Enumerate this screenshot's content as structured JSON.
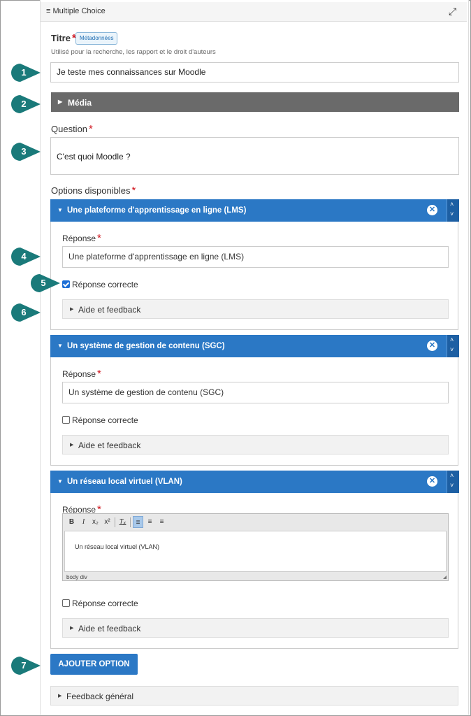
{
  "header": {
    "title": "Multiple Choice",
    "list_icon": "list-icon",
    "expand_icon": "expand-icon"
  },
  "titre": {
    "label": "Titre",
    "required": "*",
    "badge": "Métadonnées",
    "hint": "Utilisé pour la recherche, les rapport et le droit d'auteurs",
    "value": "Je teste mes connaissances sur Moodle"
  },
  "media": {
    "label": "Média"
  },
  "question": {
    "label": "Question",
    "required": "*",
    "value": "C'est quoi Moodle ?"
  },
  "options": {
    "label": "Options disponibles",
    "required": "*",
    "items": [
      {
        "title": "Une plateforme d'apprentissage en ligne (LMS)",
        "reponse_label": "Réponse",
        "required": "*",
        "value": "Une plateforme d'apprentissage en ligne (LMS)",
        "correct_label": "Réponse correcte",
        "correct": true,
        "aide": "Aide et feedback"
      },
      {
        "title": "Un système de gestion de contenu (SGC)",
        "reponse_label": "Réponse",
        "required": "*",
        "value": "Un système de gestion de contenu (SGC)",
        "correct_label": "Réponse correcte",
        "correct": false,
        "aide": "Aide et feedback"
      },
      {
        "title": "Un réseau local virtuel (VLAN)",
        "reponse_label": "Réponse",
        "required": "*",
        "value": "Un réseau local virtuel (VLAN)",
        "correct_label": "Réponse correcte",
        "correct": false,
        "aide": "Aide et feedback",
        "editor": {
          "toolbar": [
            "B",
            "I",
            "x₂",
            "x²",
            "Tₓ"
          ],
          "path": "body  div"
        }
      }
    ]
  },
  "add_button": "AJOUTER OPTION",
  "feedback_general": "Feedback général",
  "callouts": [
    "1",
    "2",
    "3",
    "4",
    "5",
    "6",
    "7"
  ],
  "colors": {
    "primary": "#2b78c5",
    "callout": "#1a7a7a",
    "media_bar": "#6a6a6a",
    "required": "#d0121b"
  }
}
